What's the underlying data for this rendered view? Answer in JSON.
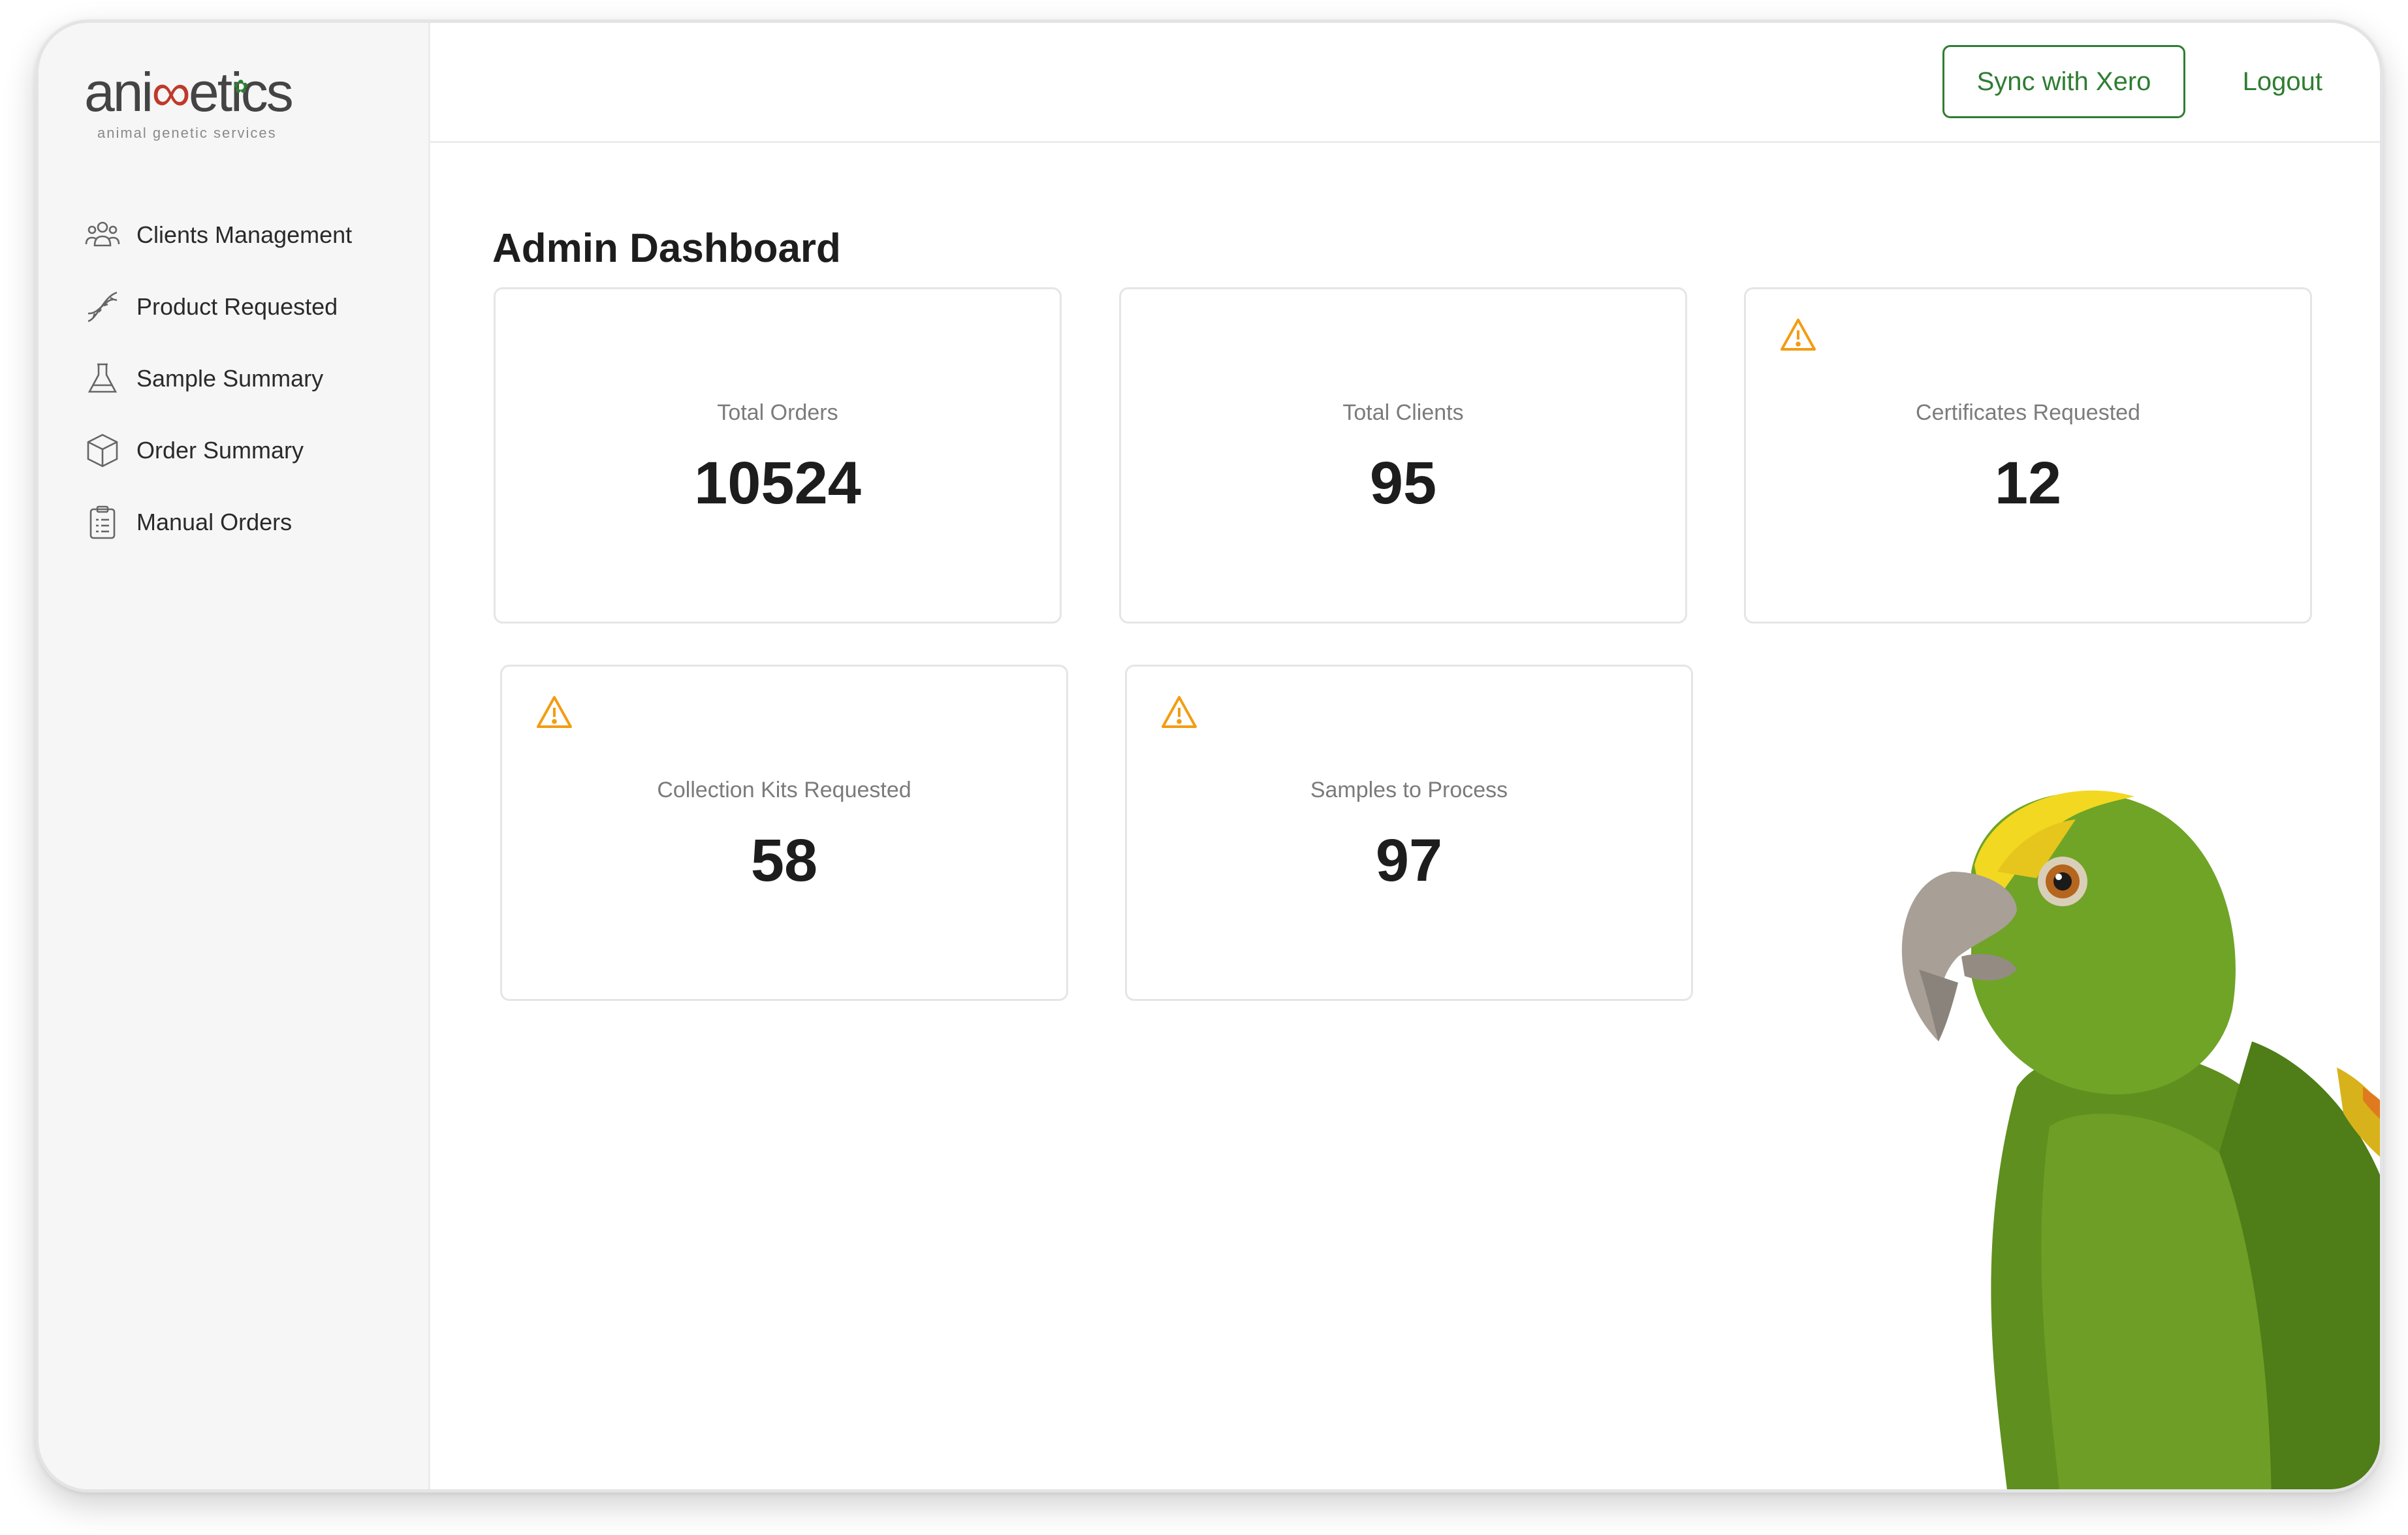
{
  "brand": {
    "logo_text": "animmetics",
    "tagline": "animal genetic services",
    "accent_color": "#2e7d32",
    "warning_color": "#f39c12"
  },
  "sidebar": {
    "items": [
      {
        "label": "Clients Management",
        "icon": "users-icon"
      },
      {
        "label": "Product Requested",
        "icon": "dna-icon"
      },
      {
        "label": "Sample Summary",
        "icon": "flask-icon"
      },
      {
        "label": "Order Summary",
        "icon": "box-icon"
      },
      {
        "label": "Manual Orders",
        "icon": "clipboard-icon"
      }
    ]
  },
  "header": {
    "sync_label": "Sync with Xero",
    "logout_label": "Logout"
  },
  "main": {
    "title": "Admin Dashboard",
    "cards": [
      {
        "label": "Total Orders",
        "value": "10524",
        "warning": false
      },
      {
        "label": "Total Clients",
        "value": "95",
        "warning": false
      },
      {
        "label": "Certificates Requested",
        "value": "12",
        "warning": true
      },
      {
        "label": "Collection Kits Requested",
        "value": "58",
        "warning": true
      },
      {
        "label": "Samples to Process",
        "value": "97",
        "warning": true
      }
    ]
  },
  "decoration": {
    "image": "parrot-illustration"
  }
}
